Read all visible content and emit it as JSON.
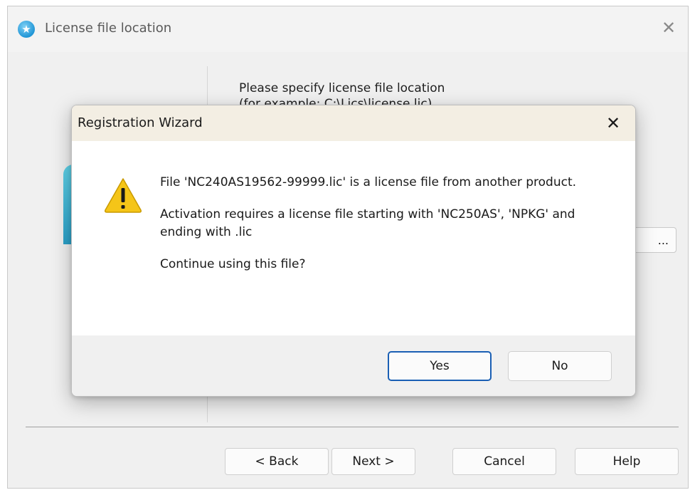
{
  "wizard": {
    "title": "License file location",
    "instruction_line1": "Please specify license file location",
    "instruction_line2": "(for example: C:\\Lics\\license.lic)",
    "browse_label": "...",
    "buttons": {
      "back": "< Back",
      "next": "Next >",
      "cancel": "Cancel",
      "help": "Help"
    }
  },
  "dialog": {
    "title": "Registration Wizard",
    "message1": "File 'NC240AS19562-99999.lic' is a license file from another product.",
    "message2": "Activation requires a license file starting with 'NC250AS', 'NPKG' and ending with .lic",
    "message3": "Continue using this file?",
    "buttons": {
      "yes": "Yes",
      "no": "No"
    },
    "icon": "warning-icon"
  },
  "colors": {
    "warning_yellow": "#f5c518",
    "accent_blue": "#1a5fb4",
    "dialog_title_bg": "#f3eee3"
  }
}
